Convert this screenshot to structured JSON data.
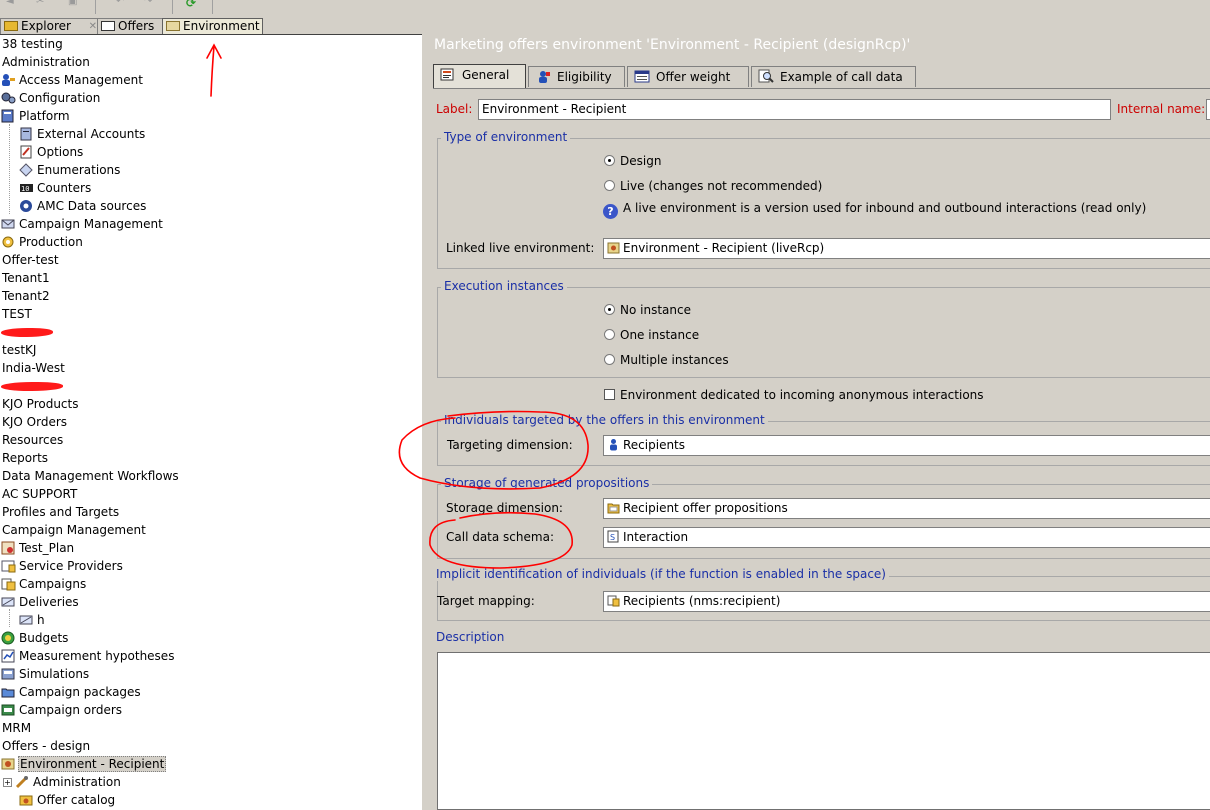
{
  "tabs": [
    {
      "label": "Explorer",
      "active": false
    },
    {
      "label": "Offers",
      "active": false
    },
    {
      "label": "Environment",
      "active": true
    }
  ],
  "tree": {
    "items": [
      {
        "label": "38 testing",
        "indent": 0,
        "icon": ""
      },
      {
        "label": "Administration",
        "indent": 0,
        "icon": ""
      },
      {
        "label": "Access Management",
        "indent": 1,
        "icon": "users-key-icon"
      },
      {
        "label": "Configuration",
        "indent": 1,
        "icon": "gears-icon"
      },
      {
        "label": "Platform",
        "indent": 1,
        "icon": "platform-icon"
      },
      {
        "label": "External Accounts",
        "indent": 2,
        "icon": "external-accounts-icon"
      },
      {
        "label": "Options",
        "indent": 2,
        "icon": "options-icon"
      },
      {
        "label": "Enumerations",
        "indent": 2,
        "icon": "enumerations-icon"
      },
      {
        "label": "Counters",
        "indent": 2,
        "icon": "counters-icon"
      },
      {
        "label": "AMC Data sources",
        "indent": 2,
        "icon": "amc-datasource-icon"
      },
      {
        "label": "Campaign Management",
        "indent": 1,
        "icon": "campaign-management-icon"
      },
      {
        "label": "Production",
        "indent": 1,
        "icon": "production-icon"
      },
      {
        "label": "Offer-test",
        "indent": 0,
        "icon": ""
      },
      {
        "label": "Tenant1",
        "indent": 0,
        "icon": ""
      },
      {
        "label": "Tenant2",
        "indent": 0,
        "icon": ""
      },
      {
        "label": "TEST",
        "indent": 0,
        "icon": ""
      },
      {
        "label": "",
        "indent": 0,
        "icon": "",
        "redacted": 52
      },
      {
        "label": "testKJ",
        "indent": 0,
        "icon": ""
      },
      {
        "label": "India-West",
        "indent": 0,
        "icon": ""
      },
      {
        "label": "",
        "indent": 0,
        "icon": "",
        "redacted": 62
      },
      {
        "label": "KJO Products",
        "indent": 0,
        "icon": ""
      },
      {
        "label": "KJO Orders",
        "indent": 0,
        "icon": ""
      },
      {
        "label": "Resources",
        "indent": 0,
        "icon": ""
      },
      {
        "label": "Reports",
        "indent": 0,
        "icon": ""
      },
      {
        "label": "Data Management Workflows",
        "indent": 0,
        "icon": ""
      },
      {
        "label": "AC SUPPORT",
        "indent": 0,
        "icon": ""
      },
      {
        "label": "Profiles and Targets",
        "indent": 0,
        "icon": ""
      },
      {
        "label": "Campaign Management",
        "indent": 0,
        "icon": ""
      },
      {
        "label": "Test_Plan",
        "indent": 1,
        "icon": "plan-icon"
      },
      {
        "label": "Service Providers",
        "indent": 1,
        "icon": "service-providers-icon"
      },
      {
        "label": "Campaigns",
        "indent": 1,
        "icon": "campaigns-icon"
      },
      {
        "label": "Deliveries",
        "indent": 1,
        "icon": "deliveries-icon"
      },
      {
        "label": "h",
        "indent": 2,
        "icon": "delivery-icon"
      },
      {
        "label": "Budgets",
        "indent": 1,
        "icon": "budgets-icon"
      },
      {
        "label": "Measurement hypotheses",
        "indent": 1,
        "icon": "hypotheses-icon"
      },
      {
        "label": "Simulations",
        "indent": 1,
        "icon": "simulations-icon"
      },
      {
        "label": "Campaign packages",
        "indent": 1,
        "icon": "packages-icon"
      },
      {
        "label": "Campaign orders",
        "indent": 1,
        "icon": "orders-icon"
      },
      {
        "label": "MRM",
        "indent": 0,
        "icon": ""
      },
      {
        "label": "Offers - design",
        "indent": 0,
        "icon": ""
      },
      {
        "label": "Environment - Recipient",
        "indent": 1,
        "icon": "environment-icon",
        "selected": true
      },
      {
        "label": "Administration",
        "indent": 2,
        "icon": "administration-icon",
        "expander": true
      },
      {
        "label": "Offer catalog",
        "indent": 2,
        "icon": "offer-catalog-icon"
      }
    ]
  },
  "form": {
    "title": "Marketing offers environment 'Environment - Recipient (designRcp)'",
    "tabs": [
      {
        "label": "General",
        "icon": "general-icon"
      },
      {
        "label": "Eligibility",
        "icon": "eligibility-icon"
      },
      {
        "label": "Offer weight",
        "icon": "offer-weight-icon"
      },
      {
        "label": "Example of call data",
        "icon": "example-call-data-icon"
      }
    ],
    "label_caption": "Label:",
    "label_value": "Environment - Recipient",
    "internal_name_caption": "Internal name:",
    "type_group": {
      "legend": "Type of environment",
      "design": "Design",
      "live": "Live (changes not recommended)",
      "info": "A live environment is a version used for inbound and outbound interactions (read only)",
      "selected": "design",
      "linked_caption": "Linked live environment:",
      "linked_value": "Environment - Recipient (liveRcp)"
    },
    "exec_group": {
      "legend": "Execution instances",
      "no_instance": "No instance",
      "one_instance": "One instance",
      "multiple_instances": "Multiple instances",
      "selected": "none",
      "anonymous_checkbox": "Environment dedicated to incoming anonymous interactions",
      "anonymous_checked": false
    },
    "individuals_group": {
      "legend": "Individuals targeted by the offers in this environment",
      "targeting_caption": "Targeting dimension:",
      "targeting_value": "Recipients"
    },
    "storage_group": {
      "legend": "Storage of generated propositions",
      "storage_caption": "Storage dimension:",
      "storage_value": "Recipient offer propositions",
      "call_data_caption": "Call data schema:",
      "call_data_value": "Interaction"
    },
    "implicit_group": {
      "legend": "Implicit identification of individuals (if the function is enabled in the space)",
      "target_mapping_caption": "Target mapping:",
      "target_mapping_value": "Recipients (nms:recipient)"
    },
    "description_legend": "Description"
  },
  "colors": {
    "window_bg": "#d4d0c8",
    "legend_blue": "#1a2fa6",
    "required_red": "#cc0000",
    "annotation_red": "#ff0000"
  }
}
